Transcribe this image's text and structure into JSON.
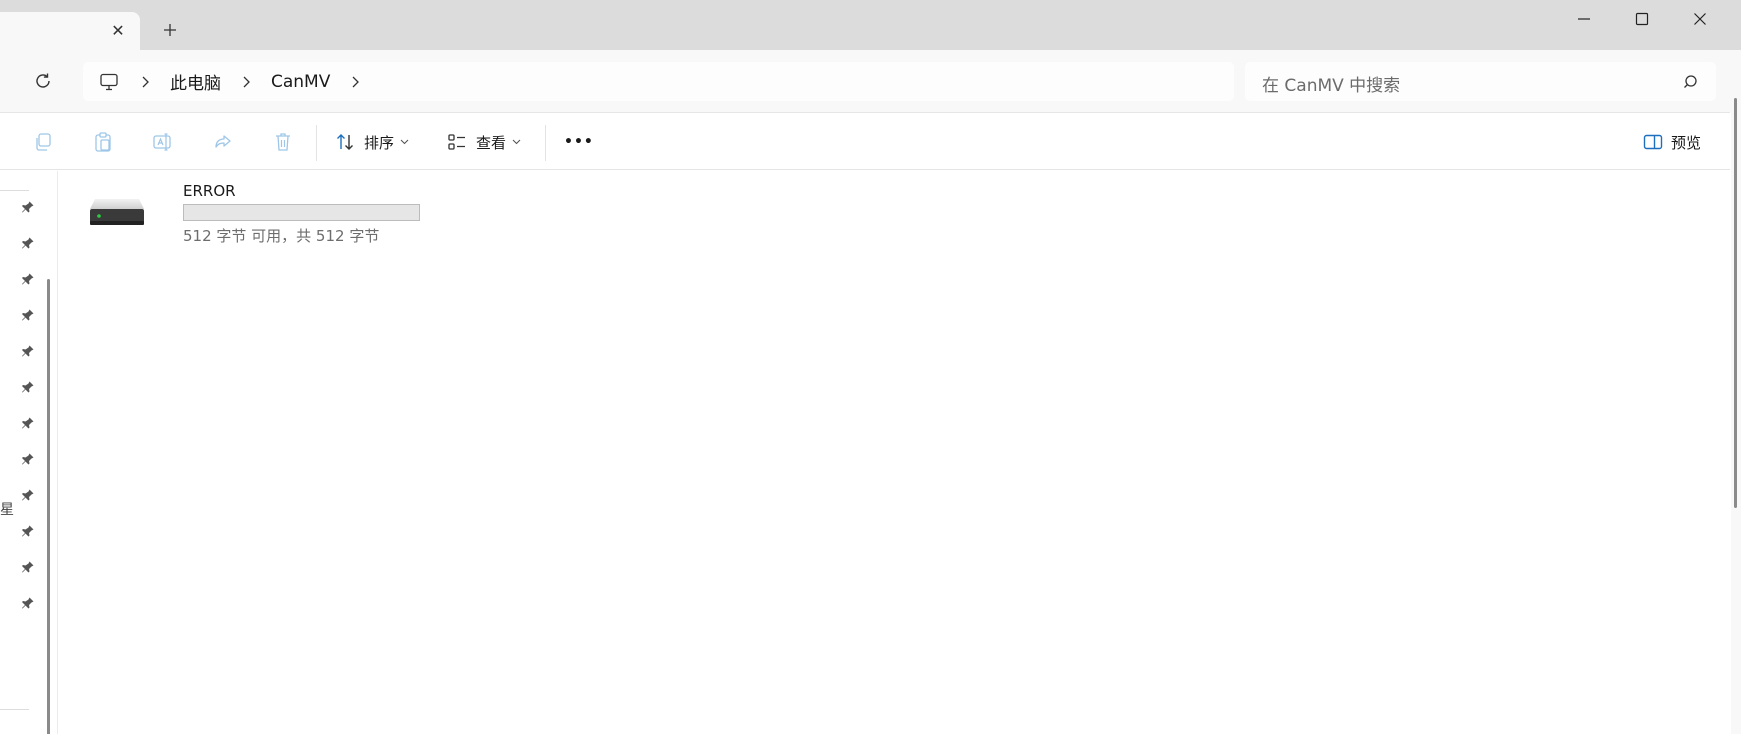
{
  "titlebar": {
    "tab_close_glyph": "✕",
    "new_tab_glyph": "+",
    "buttons": [
      "minimize-icon",
      "maximize-icon",
      "close-icon"
    ]
  },
  "address": {
    "root_icon": "computer-icon",
    "crumbs": [
      "此电脑",
      "CanMV"
    ],
    "search_placeholder": "在 CanMV 中搜索"
  },
  "toolbar": {
    "disabled_icons": [
      "copy-icon",
      "paste-icon",
      "rename-icon",
      "share-icon",
      "delete-icon"
    ],
    "sort_label": "排序",
    "view_label": "查看",
    "more_glyph": "•••",
    "preview_label": "预览"
  },
  "nav": {
    "pinned_count": 12,
    "cut_text": "星"
  },
  "drive": {
    "name": "ERROR",
    "usage_fraction": 0,
    "space_text": "512 字节 可用，共 512 字节",
    "accent": "#26a0da"
  }
}
